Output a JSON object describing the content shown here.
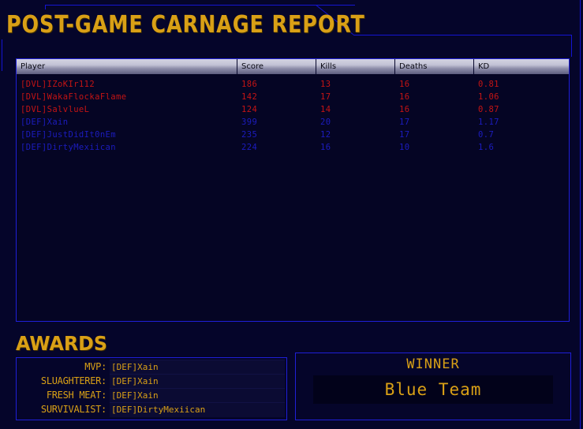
{
  "header": {
    "title": "POST-GAME CARNAGE REPORT"
  },
  "scoreboard": {
    "columns": [
      {
        "key": "player",
        "label": "Player"
      },
      {
        "key": "score",
        "label": "Score"
      },
      {
        "key": "kills",
        "label": "Kills"
      },
      {
        "key": "deaths",
        "label": "Deaths"
      },
      {
        "key": "kd",
        "label": "KD"
      }
    ],
    "rows": [
      {
        "team": "red",
        "player": "[DVL]IZoKIr112",
        "score": "186",
        "kills": "13",
        "deaths": "16",
        "kd": "0.81"
      },
      {
        "team": "red",
        "player": "[DVL]WakaFlockaFlame",
        "score": "142",
        "kills": "17",
        "deaths": "16",
        "kd": "1.06"
      },
      {
        "team": "red",
        "player": "[DVL]SalvlueL",
        "score": "124",
        "kills": "14",
        "deaths": "16",
        "kd": "0.87"
      },
      {
        "team": "blue",
        "player": "[DEF]Xain",
        "score": "399",
        "kills": "20",
        "deaths": "17",
        "kd": "1.17"
      },
      {
        "team": "blue",
        "player": "[DEF]JustDidIt0nEm",
        "score": "235",
        "kills": "12",
        "deaths": "17",
        "kd": "0.7"
      },
      {
        "team": "blue",
        "player": "[DEF]DirtyMexiican",
        "score": "224",
        "kills": "16",
        "deaths": "10",
        "kd": "1.6"
      }
    ],
    "team_colors": {
      "red": "#c41414",
      "blue": "#1c1cbe"
    }
  },
  "awards": {
    "heading": "AWARDS",
    "items": [
      {
        "label": "MVP:",
        "value": "[DEF]Xain"
      },
      {
        "label": "SLUAGHTERER:",
        "value": "[DEF]Xain"
      },
      {
        "label": "FRESH MEAT:",
        "value": "[DEF]Xain"
      },
      {
        "label": "SURVIVALIST:",
        "value": "[DEF]DirtyMexiican"
      }
    ]
  },
  "winner": {
    "label": "WINNER",
    "value": "Blue Team"
  },
  "theme": {
    "gold": "#d9a016",
    "blue_line": "#1f1fd7",
    "background": "#05052a"
  }
}
